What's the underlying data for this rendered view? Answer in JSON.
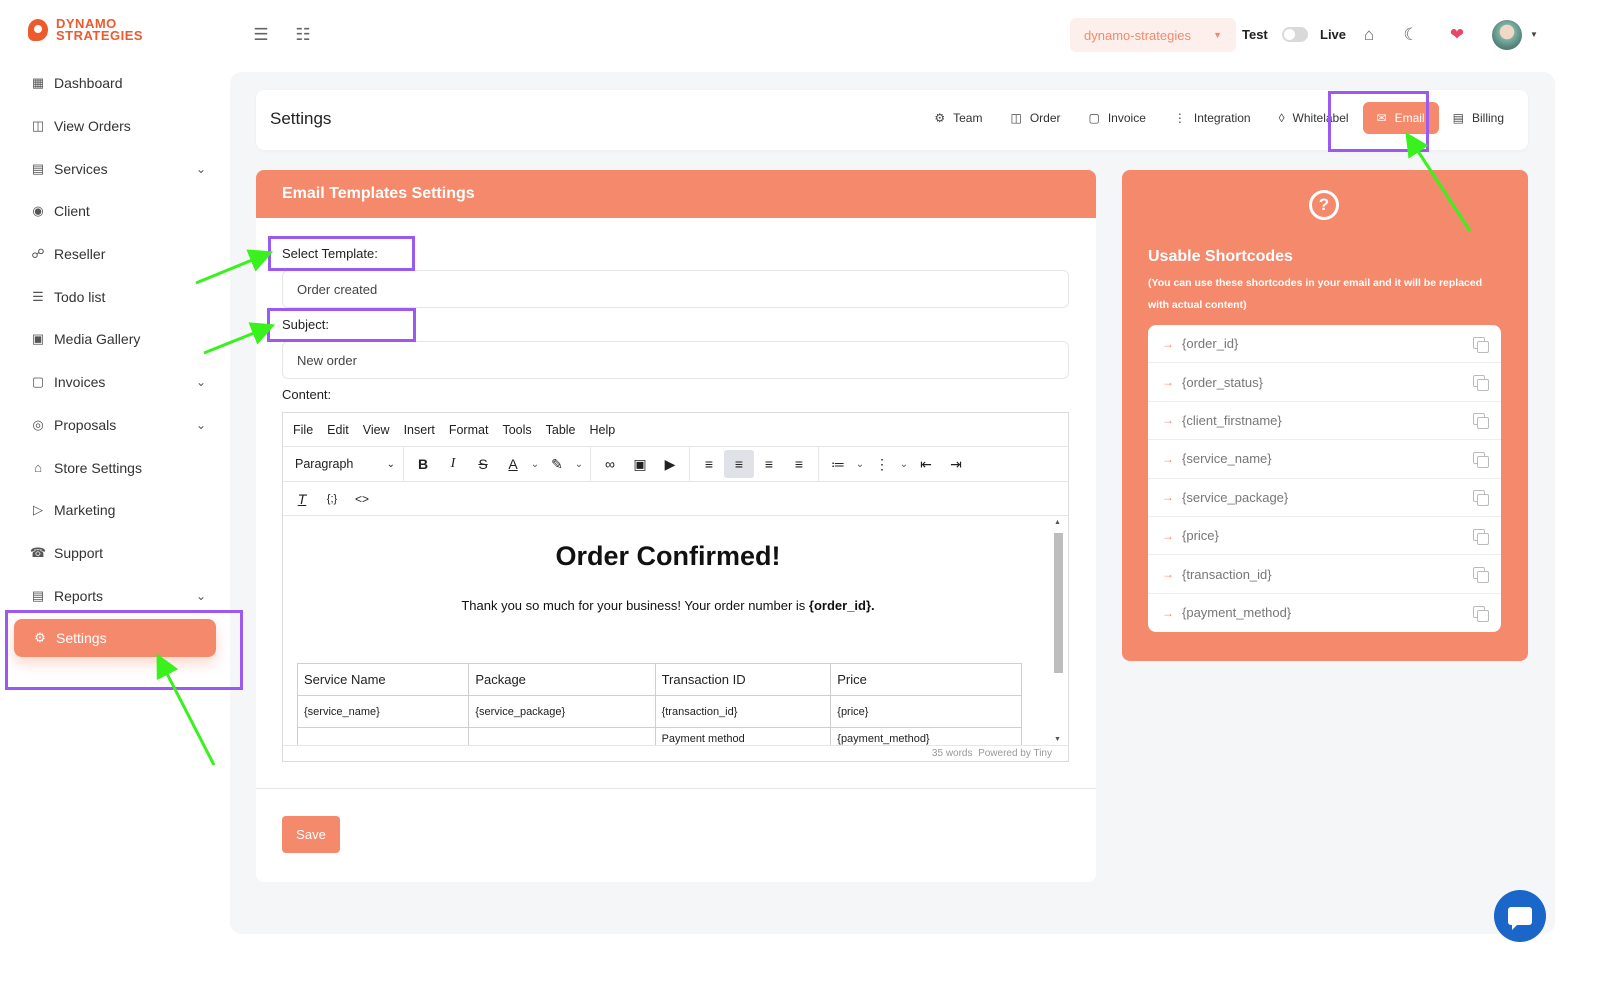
{
  "brand": {
    "line1": "DYNAMO",
    "line2": "STRATEGIES"
  },
  "sidebar": {
    "items": [
      {
        "label": "Dashboard"
      },
      {
        "label": "View Orders"
      },
      {
        "label": "Services"
      },
      {
        "label": "Client"
      },
      {
        "label": "Reseller"
      },
      {
        "label": "Todo list"
      },
      {
        "label": "Media Gallery"
      },
      {
        "label": "Invoices"
      },
      {
        "label": "Proposals"
      },
      {
        "label": "Store Settings"
      },
      {
        "label": "Marketing"
      },
      {
        "label": "Support"
      },
      {
        "label": "Reports"
      },
      {
        "label": "Settings"
      }
    ]
  },
  "header": {
    "store": "dynamo-strategies",
    "test_label": "Test",
    "live_label": "Live"
  },
  "settings": {
    "title": "Settings",
    "tabs": [
      {
        "label": "Team"
      },
      {
        "label": "Order"
      },
      {
        "label": "Invoice"
      },
      {
        "label": "Integration"
      },
      {
        "label": "Whitelabel"
      },
      {
        "label": "Email"
      },
      {
        "label": "Billing"
      }
    ],
    "active_tab": "Email"
  },
  "email": {
    "heading": "Email Templates Settings",
    "template_label": "Select Template:",
    "template_value": "Order created",
    "subject_label": "Subject:",
    "subject_value": "New order",
    "content_label": "Content:",
    "menu": [
      "File",
      "Edit",
      "View",
      "Insert",
      "Format",
      "Tools",
      "Table",
      "Help"
    ],
    "block_format": "Paragraph",
    "doc_title": "Order Confirmed!",
    "doc_text": "Thank you so much for your business! Your order number is ",
    "doc_order_code": "{order_id}.",
    "table": {
      "headers": [
        "Service Name",
        "Package",
        "Transaction ID",
        "Price"
      ],
      "row1": [
        "{service_name}",
        "{service_package}",
        "{transaction_id}",
        "{price}"
      ],
      "row2": [
        "",
        "",
        "Payment method",
        "{payment_method}"
      ]
    },
    "word_count": "35 words",
    "powered_by": "Powered by Tiny",
    "save_label": "Save"
  },
  "shortcodes": {
    "title": "Usable Shortcodes",
    "subtitle": "(You can use these shortcodes in your email and it will be replaced with actual content)",
    "items": [
      "{order_id}",
      "{order_status}",
      "{client_firstname}",
      "{service_name}",
      "{service_package}",
      "{price}",
      "{transaction_id}",
      "{payment_method}"
    ]
  },
  "colors": {
    "accent": "#f5896b",
    "brand": "#ef5a2c",
    "annotation_box": "#9a5af2",
    "annotation_arrow": "#39f11c"
  }
}
